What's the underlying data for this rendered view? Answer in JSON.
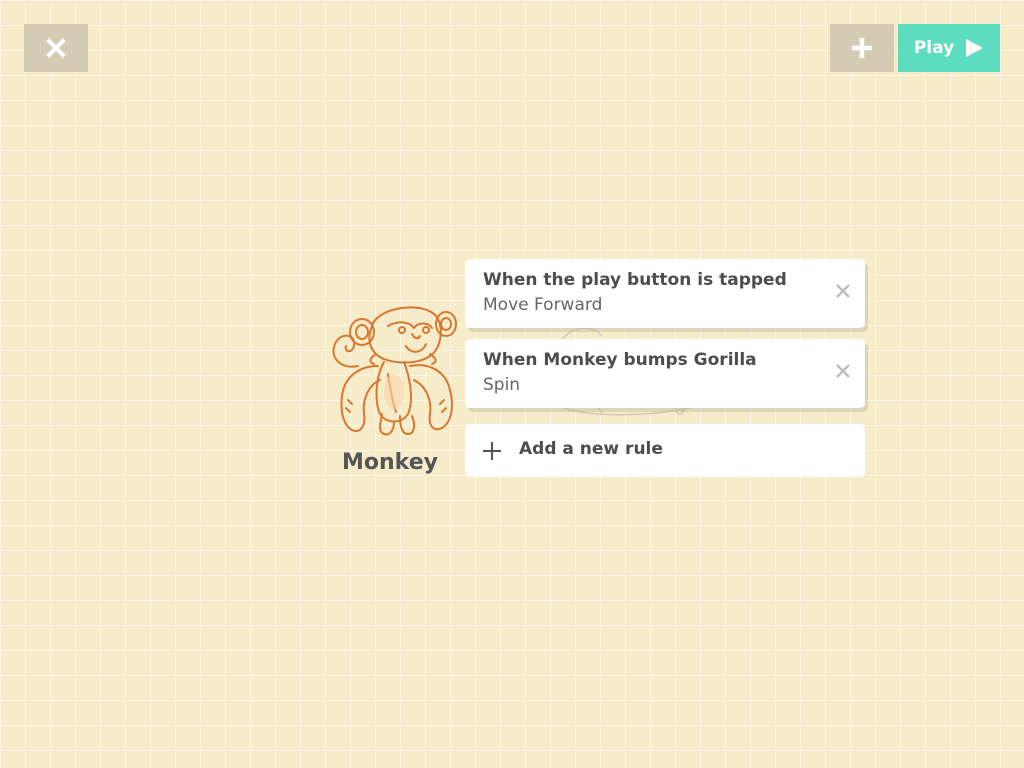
{
  "toolbar": {
    "close_icon": "close-icon",
    "add_icon": "plus-icon",
    "play_label": "Play",
    "play_icon": "play-triangle-icon",
    "play_color": "#5ddcc0",
    "button_gray": "#d3cbb4"
  },
  "character": {
    "name": "Monkey",
    "art_icon": "monkey-illustration"
  },
  "rules": [
    {
      "trigger": "When the play button is tapped",
      "action": "Move Forward"
    },
    {
      "trigger": "When Monkey bumps Gorilla",
      "action": "Spin"
    }
  ],
  "add_rule": {
    "label": "Add a new rule",
    "icon": "plus-icon"
  },
  "colors": {
    "background": "#f7ecca",
    "character_line": "#d9772e"
  }
}
